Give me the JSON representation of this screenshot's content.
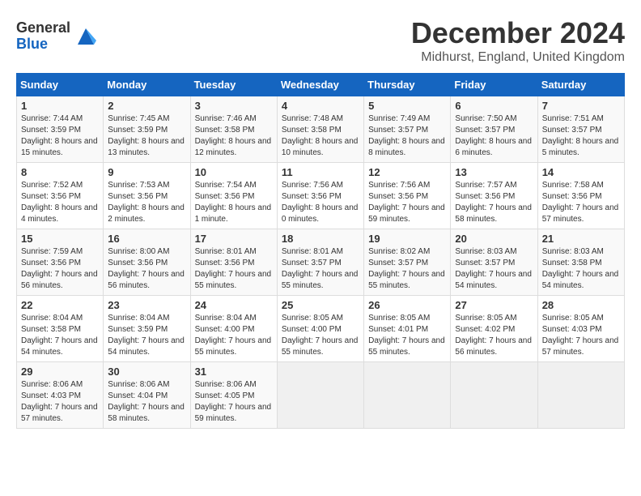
{
  "header": {
    "logo_general": "General",
    "logo_blue": "Blue",
    "title": "December 2024",
    "subtitle": "Midhurst, England, United Kingdom"
  },
  "weekdays": [
    "Sunday",
    "Monday",
    "Tuesday",
    "Wednesday",
    "Thursday",
    "Friday",
    "Saturday"
  ],
  "weeks": [
    [
      {
        "day": "1",
        "sunrise": "Sunrise: 7:44 AM",
        "sunset": "Sunset: 3:59 PM",
        "daylight": "Daylight: 8 hours and 15 minutes."
      },
      {
        "day": "2",
        "sunrise": "Sunrise: 7:45 AM",
        "sunset": "Sunset: 3:59 PM",
        "daylight": "Daylight: 8 hours and 13 minutes."
      },
      {
        "day": "3",
        "sunrise": "Sunrise: 7:46 AM",
        "sunset": "Sunset: 3:58 PM",
        "daylight": "Daylight: 8 hours and 12 minutes."
      },
      {
        "day": "4",
        "sunrise": "Sunrise: 7:48 AM",
        "sunset": "Sunset: 3:58 PM",
        "daylight": "Daylight: 8 hours and 10 minutes."
      },
      {
        "day": "5",
        "sunrise": "Sunrise: 7:49 AM",
        "sunset": "Sunset: 3:57 PM",
        "daylight": "Daylight: 8 hours and 8 minutes."
      },
      {
        "day": "6",
        "sunrise": "Sunrise: 7:50 AM",
        "sunset": "Sunset: 3:57 PM",
        "daylight": "Daylight: 8 hours and 6 minutes."
      },
      {
        "day": "7",
        "sunrise": "Sunrise: 7:51 AM",
        "sunset": "Sunset: 3:57 PM",
        "daylight": "Daylight: 8 hours and 5 minutes."
      }
    ],
    [
      {
        "day": "8",
        "sunrise": "Sunrise: 7:52 AM",
        "sunset": "Sunset: 3:56 PM",
        "daylight": "Daylight: 8 hours and 4 minutes."
      },
      {
        "day": "9",
        "sunrise": "Sunrise: 7:53 AM",
        "sunset": "Sunset: 3:56 PM",
        "daylight": "Daylight: 8 hours and 2 minutes."
      },
      {
        "day": "10",
        "sunrise": "Sunrise: 7:54 AM",
        "sunset": "Sunset: 3:56 PM",
        "daylight": "Daylight: 8 hours and 1 minute."
      },
      {
        "day": "11",
        "sunrise": "Sunrise: 7:56 AM",
        "sunset": "Sunset: 3:56 PM",
        "daylight": "Daylight: 8 hours and 0 minutes."
      },
      {
        "day": "12",
        "sunrise": "Sunrise: 7:56 AM",
        "sunset": "Sunset: 3:56 PM",
        "daylight": "Daylight: 7 hours and 59 minutes."
      },
      {
        "day": "13",
        "sunrise": "Sunrise: 7:57 AM",
        "sunset": "Sunset: 3:56 PM",
        "daylight": "Daylight: 7 hours and 58 minutes."
      },
      {
        "day": "14",
        "sunrise": "Sunrise: 7:58 AM",
        "sunset": "Sunset: 3:56 PM",
        "daylight": "Daylight: 7 hours and 57 minutes."
      }
    ],
    [
      {
        "day": "15",
        "sunrise": "Sunrise: 7:59 AM",
        "sunset": "Sunset: 3:56 PM",
        "daylight": "Daylight: 7 hours and 56 minutes."
      },
      {
        "day": "16",
        "sunrise": "Sunrise: 8:00 AM",
        "sunset": "Sunset: 3:56 PM",
        "daylight": "Daylight: 7 hours and 56 minutes."
      },
      {
        "day": "17",
        "sunrise": "Sunrise: 8:01 AM",
        "sunset": "Sunset: 3:56 PM",
        "daylight": "Daylight: 7 hours and 55 minutes."
      },
      {
        "day": "18",
        "sunrise": "Sunrise: 8:01 AM",
        "sunset": "Sunset: 3:57 PM",
        "daylight": "Daylight: 7 hours and 55 minutes."
      },
      {
        "day": "19",
        "sunrise": "Sunrise: 8:02 AM",
        "sunset": "Sunset: 3:57 PM",
        "daylight": "Daylight: 7 hours and 55 minutes."
      },
      {
        "day": "20",
        "sunrise": "Sunrise: 8:03 AM",
        "sunset": "Sunset: 3:57 PM",
        "daylight": "Daylight: 7 hours and 54 minutes."
      },
      {
        "day": "21",
        "sunrise": "Sunrise: 8:03 AM",
        "sunset": "Sunset: 3:58 PM",
        "daylight": "Daylight: 7 hours and 54 minutes."
      }
    ],
    [
      {
        "day": "22",
        "sunrise": "Sunrise: 8:04 AM",
        "sunset": "Sunset: 3:58 PM",
        "daylight": "Daylight: 7 hours and 54 minutes."
      },
      {
        "day": "23",
        "sunrise": "Sunrise: 8:04 AM",
        "sunset": "Sunset: 3:59 PM",
        "daylight": "Daylight: 7 hours and 54 minutes."
      },
      {
        "day": "24",
        "sunrise": "Sunrise: 8:04 AM",
        "sunset": "Sunset: 4:00 PM",
        "daylight": "Daylight: 7 hours and 55 minutes."
      },
      {
        "day": "25",
        "sunrise": "Sunrise: 8:05 AM",
        "sunset": "Sunset: 4:00 PM",
        "daylight": "Daylight: 7 hours and 55 minutes."
      },
      {
        "day": "26",
        "sunrise": "Sunrise: 8:05 AM",
        "sunset": "Sunset: 4:01 PM",
        "daylight": "Daylight: 7 hours and 55 minutes."
      },
      {
        "day": "27",
        "sunrise": "Sunrise: 8:05 AM",
        "sunset": "Sunset: 4:02 PM",
        "daylight": "Daylight: 7 hours and 56 minutes."
      },
      {
        "day": "28",
        "sunrise": "Sunrise: 8:05 AM",
        "sunset": "Sunset: 4:03 PM",
        "daylight": "Daylight: 7 hours and 57 minutes."
      }
    ],
    [
      {
        "day": "29",
        "sunrise": "Sunrise: 8:06 AM",
        "sunset": "Sunset: 4:03 PM",
        "daylight": "Daylight: 7 hours and 57 minutes."
      },
      {
        "day": "30",
        "sunrise": "Sunrise: 8:06 AM",
        "sunset": "Sunset: 4:04 PM",
        "daylight": "Daylight: 7 hours and 58 minutes."
      },
      {
        "day": "31",
        "sunrise": "Sunrise: 8:06 AM",
        "sunset": "Sunset: 4:05 PM",
        "daylight": "Daylight: 7 hours and 59 minutes."
      },
      null,
      null,
      null,
      null
    ]
  ]
}
